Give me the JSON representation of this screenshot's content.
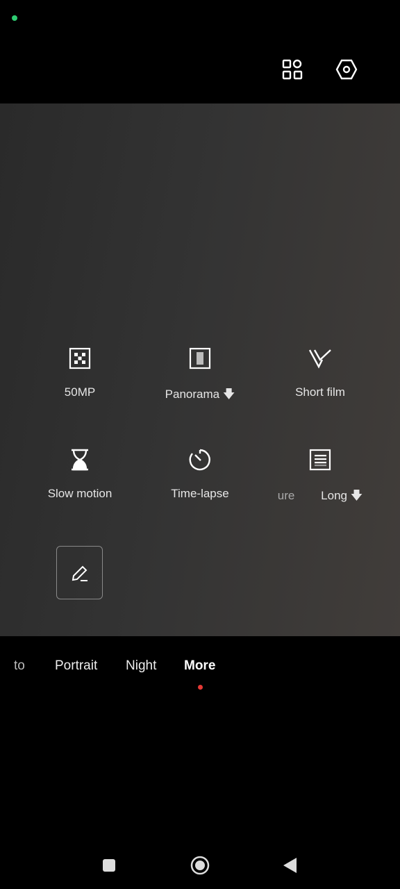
{
  "status": {
    "indicator_color": "#2ecc71"
  },
  "top_bar": {
    "icons": [
      "grid-icon",
      "settings-hexagon-icon"
    ]
  },
  "modes": [
    {
      "label": "50MP",
      "icon": "50mp-icon"
    },
    {
      "label": "Panorama",
      "icon": "panorama-icon",
      "download": true
    },
    {
      "label": "Short film",
      "icon": "short-film-icon"
    },
    {
      "label": "Slow motion",
      "icon": "hourglass-icon"
    },
    {
      "label": "Time-lapse",
      "icon": "timer-icon"
    },
    {
      "label_prefix": "ure",
      "label": "Long",
      "icon": "long-exposure-icon",
      "download": true
    }
  ],
  "edit_button": {
    "icon": "edit-pencil-icon"
  },
  "tabs": [
    {
      "label": "to"
    },
    {
      "label": "Portrait"
    },
    {
      "label": "Night"
    },
    {
      "label": "More",
      "active": true
    }
  ],
  "accent": "#e53935"
}
